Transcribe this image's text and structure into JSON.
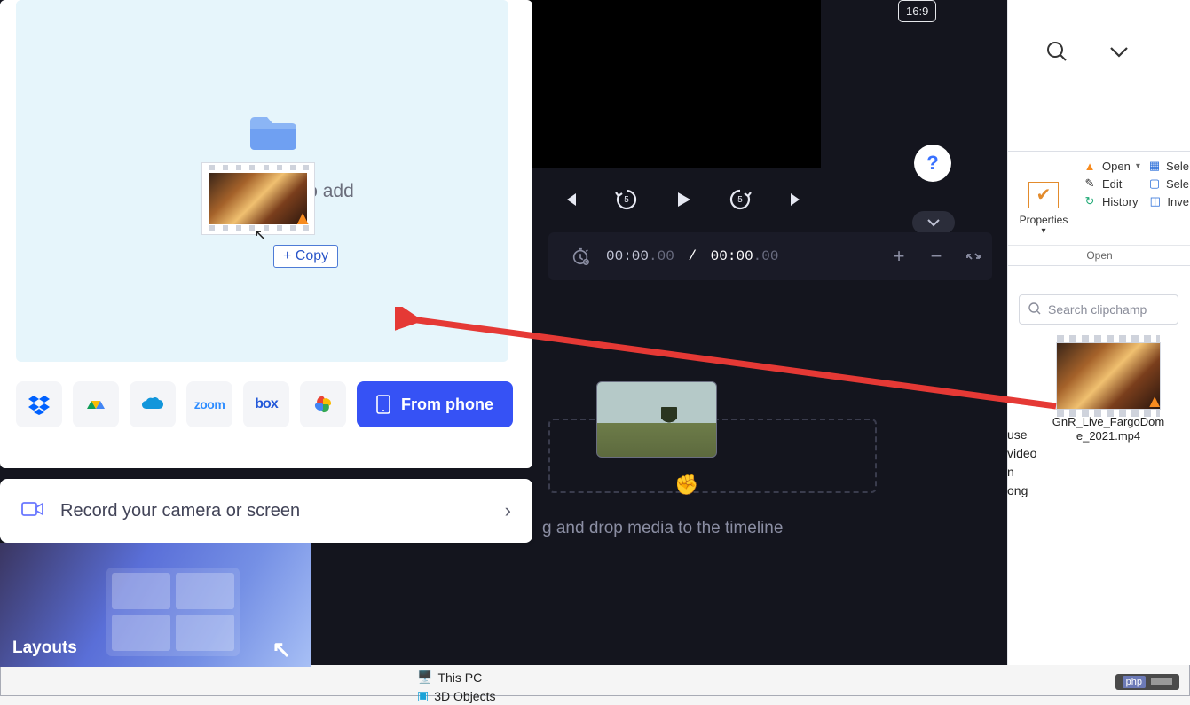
{
  "aspect_ratio": "16:9",
  "help_symbol": "?",
  "playback": {
    "back5": "5",
    "fwd5": "5"
  },
  "timecode": {
    "current": "00:00",
    "current_frac": ".00",
    "sep": "/",
    "total": "00:00",
    "total_frac": ".00"
  },
  "timeline_hint": "g and drop media to the timeline",
  "left": {
    "drop_label": "Drop media to add",
    "copy_badge": "+ Copy",
    "sources": {
      "dropbox": "dropbox",
      "gdrive": "gdrive",
      "onedrive": "onedrive",
      "zoom": "zoom",
      "box": "box",
      "gphotos": "gphotos"
    },
    "from_phone": "From phone",
    "record_label": "Record your camera or screen",
    "layouts_label": "Layouts"
  },
  "ribbon": {
    "properties": "Properties",
    "open": "Open",
    "edit": "Edit",
    "history": "History",
    "sele1": "Sele",
    "sele2": "Sele",
    "inve": "Inve",
    "open_group": "Open"
  },
  "search_placeholder": "Search clipchamp",
  "file": {
    "name": "GnR_Live_FargoDome_2021.mp4"
  },
  "covered": {
    "l1": "use",
    "l2": "video",
    "l3": "n",
    "l4": "ong"
  },
  "tree": {
    "this_pc": "This PC",
    "objects_3d": "3D Objects"
  },
  "php": "php"
}
